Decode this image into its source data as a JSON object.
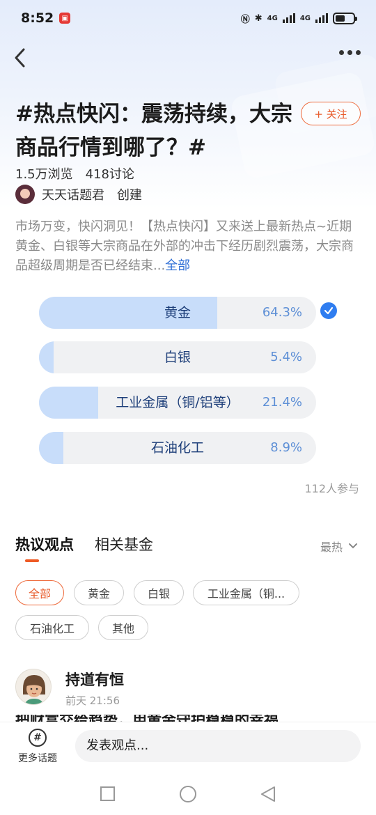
{
  "status_bar": {
    "time": "8:52",
    "network_1": "4G",
    "network_2": "4G"
  },
  "topic": {
    "title": "#热点快闪：震荡持续，大宗商品行情到哪了？#",
    "follow_label": "+ 关注",
    "views": "1.5万浏览",
    "discussions": "418讨论",
    "creator_name": "天天话题君",
    "creator_role": "创建",
    "description": "市场万变，快闪洞见！【热点快闪】又来送上最新热点~近期黄金、白银等大宗商品在外部的冲击下经历剧烈震荡，大宗商品超级周期是否已经结束...",
    "description_more": "全部"
  },
  "poll": {
    "options": [
      {
        "label": "黄金",
        "percent": "64.3%",
        "value": 64.3,
        "selected": true
      },
      {
        "label": "白银",
        "percent": "5.4%",
        "value": 5.4,
        "selected": false
      },
      {
        "label": "工业金属（铜/铝等）",
        "percent": "21.4%",
        "value": 21.4,
        "selected": false
      },
      {
        "label": "石油化工",
        "percent": "8.9%",
        "value": 8.9,
        "selected": false
      }
    ],
    "participants": "112人参与"
  },
  "tabs": {
    "items": [
      "热议观点",
      "相关基金"
    ],
    "active": 0,
    "sort_label": "最热"
  },
  "filters": [
    "全部",
    "黄金",
    "白银",
    "工业金属（铜...",
    "石油化工",
    "其他"
  ],
  "comment": {
    "user": "持道有恒",
    "time": "前天 21:56",
    "text_preview": "把财富交给趋势，用黄金守护稳稳的幸福"
  },
  "bottom_bar": {
    "more_topics_label": "更多话题",
    "input_placeholder": "发表观点..."
  },
  "colors": {
    "accent_orange": "#ee6a3b",
    "poll_fill": "#c8ddfa",
    "poll_text": "#1e3f7a",
    "check_blue": "#2f7df0"
  }
}
